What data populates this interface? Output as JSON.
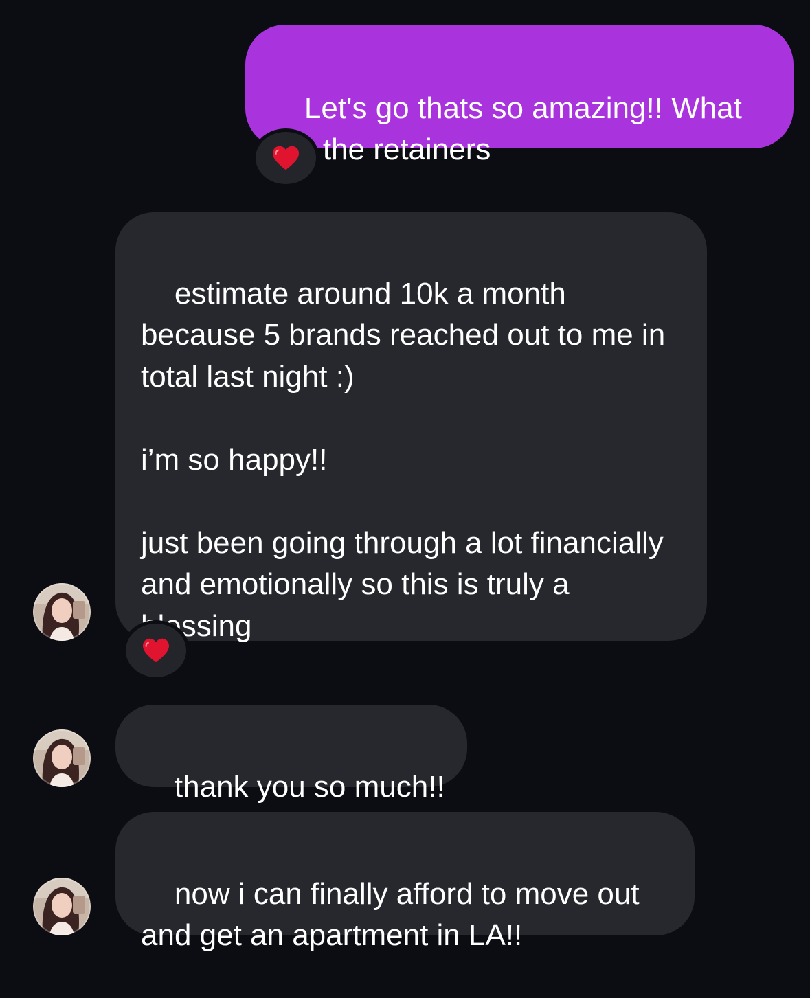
{
  "conversation": {
    "messages": [
      {
        "direction": "sent",
        "text": "Let's go thats so amazing!! What are the retainers",
        "reaction": "heart-icon"
      },
      {
        "direction": "received",
        "text": "estimate around 10k a month because 5 brands reached out to me in total last night :)\n\ni’m so happy!!\n\njust been going through a lot financially and emotionally so this is truly a blessing",
        "reaction": "heart-icon"
      },
      {
        "direction": "received",
        "text": "thank you so much!!"
      },
      {
        "direction": "received",
        "text": "now i can finally afford to move out and get an apartment in LA!!"
      }
    ]
  },
  "colors": {
    "background": "#0b0d13",
    "sent_bubble": "#a933dc",
    "received_bubble": "#26282e",
    "reaction_heart": "#e0142f"
  }
}
